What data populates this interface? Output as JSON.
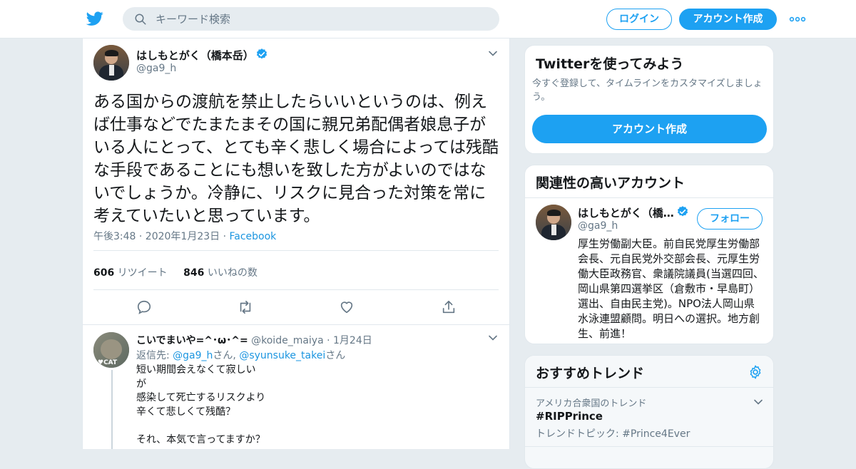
{
  "header": {
    "search_placeholder": "キーワード検索",
    "login_label": "ログイン",
    "signup_label": "アカウント作成",
    "brand_color": "#1da1f2"
  },
  "tweet": {
    "name": "はしもとがく（橋本岳）",
    "handle": "@ga9_h",
    "text": "ある国からの渡航を禁止したらいいというのは、例えば仕事などでたまたまその国に親兄弟配偶者娘息子がいる人にとって、とても辛く悲しく場合によっては残酷な手段であることにも想いを致した方がよいのではないでしょうか。冷静に、リスクに見合った対策を常に考えていたいと思っています。",
    "time": "午後3:48 · 2020年1月23日",
    "separator": "·",
    "source": "Facebook",
    "retweet_count": "606",
    "retweet_label": "リツイート",
    "like_count": "846",
    "like_label": "いいねの数"
  },
  "reply": {
    "name": "こいでまいや=^･ω･^=",
    "handle": "@koide_maiya",
    "date": "· 1月24日",
    "reply_prefix": "返信先: ",
    "reply_user1": "@ga9_h",
    "reply_san1": "さん, ",
    "reply_user2": "@syunsuke_takei",
    "reply_san2": "さん",
    "text": "短い期間会えなくて寂しい\nが\n感染して死亡するリスクより\n辛くて悲しくて残酷？\n\nそれ、本気で言ってますか？",
    "avatar_label": "♥CAT"
  },
  "sidebar": {
    "try": {
      "title": "Twitterを使ってみよう",
      "desc": "今すぐ登録して、タイムラインをカスタマイズしましょう。",
      "button": "アカウント作成"
    },
    "related": {
      "title": "関連性の高いアカウント",
      "name": "はしもとがく（橋…",
      "handle": "@ga9_h",
      "follow": "フォロー",
      "bio": "厚生労働副大臣。前自民党厚生労働部会長、元自民党外交部会長、元厚生労働大臣政務官、衆議院議員(当選四回、岡山県第四選挙区（倉敷市・早島町）選出、自由民主党)。NPO法人岡山県水泳連盟顧問。明日への選択。地方創生、前進！"
    },
    "trends": {
      "title": "おすすめトレンド",
      "location": "アメリカ合衆国のトレンド",
      "name": "#RIPPrince",
      "sub": "トレンドトピック: #Prince4Ever"
    }
  }
}
